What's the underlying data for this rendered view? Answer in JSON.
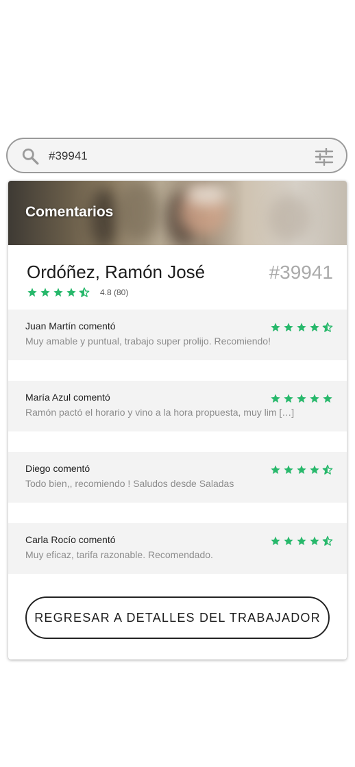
{
  "search": {
    "value": "#39941",
    "search_icon": "search-icon",
    "filter_icon": "sliders-icon"
  },
  "card": {
    "banner_title": "Comentarios",
    "worker": {
      "name": "Ordóñez, Ramón José",
      "id": "#39941",
      "rating": 4.5,
      "rating_text": "4.8 (80)"
    },
    "comments": [
      {
        "author": "Juan Martín comentó",
        "text": "Muy amable y puntual, trabajo super prolijo. Recomiendo!",
        "rating": 4.5
      },
      {
        "author": "María Azul comentó",
        "text": "Ramón pactó el horario y vino a la hora propuesta, muy lim […]",
        "rating": 5
      },
      {
        "author": "Diego comentó",
        "text": "Todo bien,, recomiendo ! Saludos desde Saladas",
        "rating": 4.5
      },
      {
        "author": "Carla Rocío comentó",
        "text": "Muy eficaz, tarifa razonable. Recomendado.",
        "rating": 4.5
      }
    ],
    "back_button_label": "REGRESAR A DETALLES DEL TRABAJADOR"
  },
  "colors": {
    "star": "#27b86b",
    "background": "#ffffff",
    "comment_bg": "#f3f3f3"
  }
}
